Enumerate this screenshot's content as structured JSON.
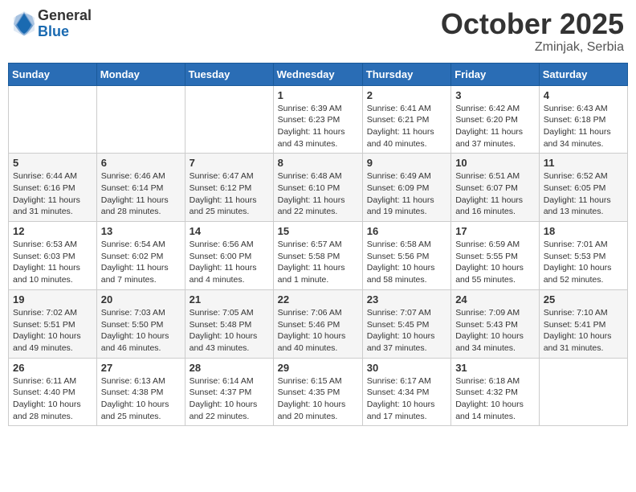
{
  "header": {
    "logo_general": "General",
    "logo_blue": "Blue",
    "month_title": "October 2025",
    "location": "Zminjak, Serbia"
  },
  "days_of_week": [
    "Sunday",
    "Monday",
    "Tuesday",
    "Wednesday",
    "Thursday",
    "Friday",
    "Saturday"
  ],
  "weeks": [
    [
      {
        "day": "",
        "info": ""
      },
      {
        "day": "",
        "info": ""
      },
      {
        "day": "",
        "info": ""
      },
      {
        "day": "1",
        "info": "Sunrise: 6:39 AM\nSunset: 6:23 PM\nDaylight: 11 hours and 43 minutes."
      },
      {
        "day": "2",
        "info": "Sunrise: 6:41 AM\nSunset: 6:21 PM\nDaylight: 11 hours and 40 minutes."
      },
      {
        "day": "3",
        "info": "Sunrise: 6:42 AM\nSunset: 6:20 PM\nDaylight: 11 hours and 37 minutes."
      },
      {
        "day": "4",
        "info": "Sunrise: 6:43 AM\nSunset: 6:18 PM\nDaylight: 11 hours and 34 minutes."
      }
    ],
    [
      {
        "day": "5",
        "info": "Sunrise: 6:44 AM\nSunset: 6:16 PM\nDaylight: 11 hours and 31 minutes."
      },
      {
        "day": "6",
        "info": "Sunrise: 6:46 AM\nSunset: 6:14 PM\nDaylight: 11 hours and 28 minutes."
      },
      {
        "day": "7",
        "info": "Sunrise: 6:47 AM\nSunset: 6:12 PM\nDaylight: 11 hours and 25 minutes."
      },
      {
        "day": "8",
        "info": "Sunrise: 6:48 AM\nSunset: 6:10 PM\nDaylight: 11 hours and 22 minutes."
      },
      {
        "day": "9",
        "info": "Sunrise: 6:49 AM\nSunset: 6:09 PM\nDaylight: 11 hours and 19 minutes."
      },
      {
        "day": "10",
        "info": "Sunrise: 6:51 AM\nSunset: 6:07 PM\nDaylight: 11 hours and 16 minutes."
      },
      {
        "day": "11",
        "info": "Sunrise: 6:52 AM\nSunset: 6:05 PM\nDaylight: 11 hours and 13 minutes."
      }
    ],
    [
      {
        "day": "12",
        "info": "Sunrise: 6:53 AM\nSunset: 6:03 PM\nDaylight: 11 hours and 10 minutes."
      },
      {
        "day": "13",
        "info": "Sunrise: 6:54 AM\nSunset: 6:02 PM\nDaylight: 11 hours and 7 minutes."
      },
      {
        "day": "14",
        "info": "Sunrise: 6:56 AM\nSunset: 6:00 PM\nDaylight: 11 hours and 4 minutes."
      },
      {
        "day": "15",
        "info": "Sunrise: 6:57 AM\nSunset: 5:58 PM\nDaylight: 11 hours and 1 minute."
      },
      {
        "day": "16",
        "info": "Sunrise: 6:58 AM\nSunset: 5:56 PM\nDaylight: 10 hours and 58 minutes."
      },
      {
        "day": "17",
        "info": "Sunrise: 6:59 AM\nSunset: 5:55 PM\nDaylight: 10 hours and 55 minutes."
      },
      {
        "day": "18",
        "info": "Sunrise: 7:01 AM\nSunset: 5:53 PM\nDaylight: 10 hours and 52 minutes."
      }
    ],
    [
      {
        "day": "19",
        "info": "Sunrise: 7:02 AM\nSunset: 5:51 PM\nDaylight: 10 hours and 49 minutes."
      },
      {
        "day": "20",
        "info": "Sunrise: 7:03 AM\nSunset: 5:50 PM\nDaylight: 10 hours and 46 minutes."
      },
      {
        "day": "21",
        "info": "Sunrise: 7:05 AM\nSunset: 5:48 PM\nDaylight: 10 hours and 43 minutes."
      },
      {
        "day": "22",
        "info": "Sunrise: 7:06 AM\nSunset: 5:46 PM\nDaylight: 10 hours and 40 minutes."
      },
      {
        "day": "23",
        "info": "Sunrise: 7:07 AM\nSunset: 5:45 PM\nDaylight: 10 hours and 37 minutes."
      },
      {
        "day": "24",
        "info": "Sunrise: 7:09 AM\nSunset: 5:43 PM\nDaylight: 10 hours and 34 minutes."
      },
      {
        "day": "25",
        "info": "Sunrise: 7:10 AM\nSunset: 5:41 PM\nDaylight: 10 hours and 31 minutes."
      }
    ],
    [
      {
        "day": "26",
        "info": "Sunrise: 6:11 AM\nSunset: 4:40 PM\nDaylight: 10 hours and 28 minutes."
      },
      {
        "day": "27",
        "info": "Sunrise: 6:13 AM\nSunset: 4:38 PM\nDaylight: 10 hours and 25 minutes."
      },
      {
        "day": "28",
        "info": "Sunrise: 6:14 AM\nSunset: 4:37 PM\nDaylight: 10 hours and 22 minutes."
      },
      {
        "day": "29",
        "info": "Sunrise: 6:15 AM\nSunset: 4:35 PM\nDaylight: 10 hours and 20 minutes."
      },
      {
        "day": "30",
        "info": "Sunrise: 6:17 AM\nSunset: 4:34 PM\nDaylight: 10 hours and 17 minutes."
      },
      {
        "day": "31",
        "info": "Sunrise: 6:18 AM\nSunset: 4:32 PM\nDaylight: 10 hours and 14 minutes."
      },
      {
        "day": "",
        "info": ""
      }
    ]
  ]
}
